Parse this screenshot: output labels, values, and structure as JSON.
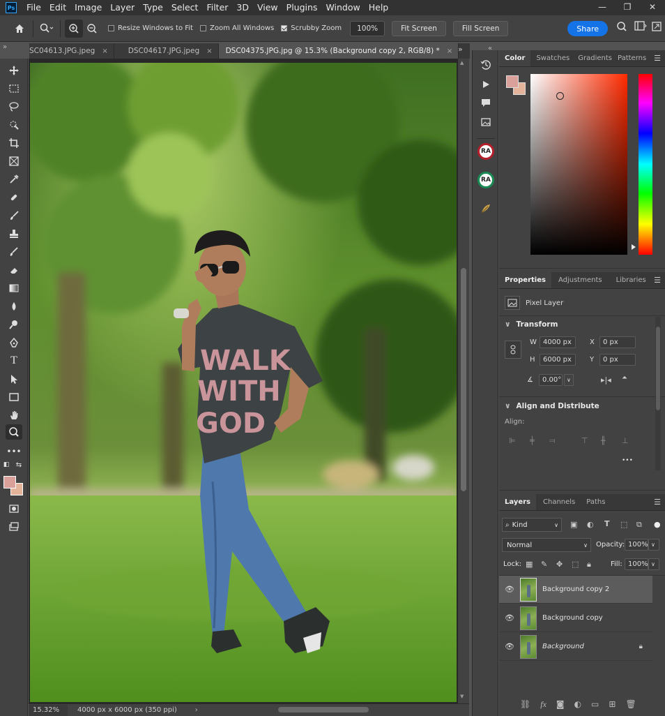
{
  "app": {
    "logo": "Ps",
    "menu": [
      "File",
      "Edit",
      "Image",
      "Layer",
      "Type",
      "Select",
      "Filter",
      "3D",
      "View",
      "Plugins",
      "Window",
      "Help"
    ],
    "window_controls": {
      "minimize": "—",
      "restore": "❐",
      "close": "✕"
    }
  },
  "options": {
    "resize_windows": "Resize Windows to Fit",
    "zoom_all": "Zoom All Windows",
    "scrubby": "Scrubby Zoom",
    "zoom_value": "100%",
    "fit_screen": "Fit Screen",
    "fill_screen": "Fill Screen",
    "share": "Share"
  },
  "tabs": [
    {
      "label": "SC04613.JPG.jpeg",
      "close": "×"
    },
    {
      "label": "DSC04617.JPG.jpeg",
      "close": "×"
    },
    {
      "label": "DSC04375.JPG.jpg @ 15.3% (Background copy 2, RGB/8) *",
      "close": "×"
    }
  ],
  "status": {
    "zoom": "15.32%",
    "doc_info": "4000 px x 6000 px (350 ppi)",
    "arrow": "›"
  },
  "tshirt_text": [
    "WALK",
    "WITH",
    "GOD"
  ],
  "dock": {
    "ra1": "RA",
    "ra2": "RA"
  },
  "color_panel": {
    "tabs": [
      "Color",
      "Swatches",
      "Gradients",
      "Patterns"
    ],
    "foreground": "#d9a19a",
    "background": "#e3b39a"
  },
  "properties": {
    "tabs": [
      "Properties",
      "Adjustments",
      "Libraries"
    ],
    "layer_type": "Pixel Layer",
    "transform_title": "Transform",
    "w_label": "W",
    "w": "4000 px",
    "h_label": "H",
    "h": "6000 px",
    "x_label": "X",
    "x": "0 px",
    "y_label": "Y",
    "y": "0 px",
    "angle": "0.00°",
    "align_title": "Align and Distribute",
    "align_label": "Align:",
    "more": "•••"
  },
  "layers": {
    "tabs": [
      "Layers",
      "Channels",
      "Paths"
    ],
    "kind": "Kind",
    "blend_mode": "Normal",
    "opacity_label": "Opacity:",
    "opacity": "100%",
    "lock_label": "Lock:",
    "fill_label": "Fill:",
    "fill": "100%",
    "items": [
      {
        "name": "Background copy 2"
      },
      {
        "name": "Background copy"
      },
      {
        "name": "Background"
      }
    ]
  }
}
